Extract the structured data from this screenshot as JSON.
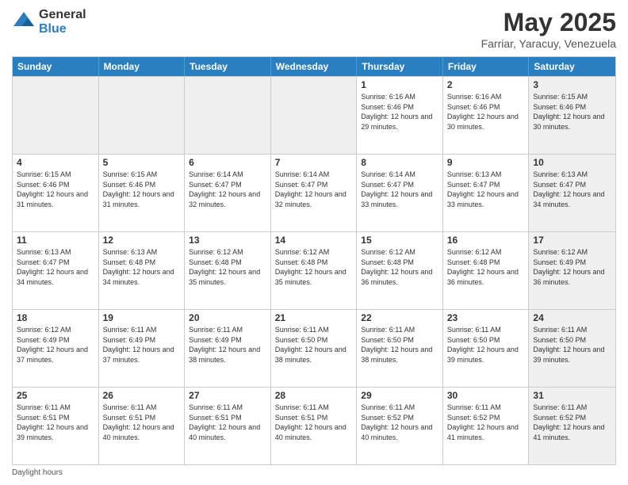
{
  "logo": {
    "general": "General",
    "blue": "Blue"
  },
  "title": "May 2025",
  "subtitle": "Farriar, Yaracuy, Venezuela",
  "days_header": [
    "Sunday",
    "Monday",
    "Tuesday",
    "Wednesday",
    "Thursday",
    "Friday",
    "Saturday"
  ],
  "footer": "Daylight hours",
  "weeks": [
    [
      {
        "day": "",
        "info": "",
        "shaded": true
      },
      {
        "day": "",
        "info": "",
        "shaded": true
      },
      {
        "day": "",
        "info": "",
        "shaded": true
      },
      {
        "day": "",
        "info": "",
        "shaded": true
      },
      {
        "day": "1",
        "info": "Sunrise: 6:16 AM\nSunset: 6:46 PM\nDaylight: 12 hours\nand 29 minutes.",
        "shaded": false
      },
      {
        "day": "2",
        "info": "Sunrise: 6:16 AM\nSunset: 6:46 PM\nDaylight: 12 hours\nand 30 minutes.",
        "shaded": false
      },
      {
        "day": "3",
        "info": "Sunrise: 6:15 AM\nSunset: 6:46 PM\nDaylight: 12 hours\nand 30 minutes.",
        "shaded": true
      }
    ],
    [
      {
        "day": "4",
        "info": "Sunrise: 6:15 AM\nSunset: 6:46 PM\nDaylight: 12 hours\nand 31 minutes.",
        "shaded": false
      },
      {
        "day": "5",
        "info": "Sunrise: 6:15 AM\nSunset: 6:46 PM\nDaylight: 12 hours\nand 31 minutes.",
        "shaded": false
      },
      {
        "day": "6",
        "info": "Sunrise: 6:14 AM\nSunset: 6:47 PM\nDaylight: 12 hours\nand 32 minutes.",
        "shaded": false
      },
      {
        "day": "7",
        "info": "Sunrise: 6:14 AM\nSunset: 6:47 PM\nDaylight: 12 hours\nand 32 minutes.",
        "shaded": false
      },
      {
        "day": "8",
        "info": "Sunrise: 6:14 AM\nSunset: 6:47 PM\nDaylight: 12 hours\nand 33 minutes.",
        "shaded": false
      },
      {
        "day": "9",
        "info": "Sunrise: 6:13 AM\nSunset: 6:47 PM\nDaylight: 12 hours\nand 33 minutes.",
        "shaded": false
      },
      {
        "day": "10",
        "info": "Sunrise: 6:13 AM\nSunset: 6:47 PM\nDaylight: 12 hours\nand 34 minutes.",
        "shaded": true
      }
    ],
    [
      {
        "day": "11",
        "info": "Sunrise: 6:13 AM\nSunset: 6:47 PM\nDaylight: 12 hours\nand 34 minutes.",
        "shaded": false
      },
      {
        "day": "12",
        "info": "Sunrise: 6:13 AM\nSunset: 6:48 PM\nDaylight: 12 hours\nand 34 minutes.",
        "shaded": false
      },
      {
        "day": "13",
        "info": "Sunrise: 6:12 AM\nSunset: 6:48 PM\nDaylight: 12 hours\nand 35 minutes.",
        "shaded": false
      },
      {
        "day": "14",
        "info": "Sunrise: 6:12 AM\nSunset: 6:48 PM\nDaylight: 12 hours\nand 35 minutes.",
        "shaded": false
      },
      {
        "day": "15",
        "info": "Sunrise: 6:12 AM\nSunset: 6:48 PM\nDaylight: 12 hours\nand 36 minutes.",
        "shaded": false
      },
      {
        "day": "16",
        "info": "Sunrise: 6:12 AM\nSunset: 6:48 PM\nDaylight: 12 hours\nand 36 minutes.",
        "shaded": false
      },
      {
        "day": "17",
        "info": "Sunrise: 6:12 AM\nSunset: 6:49 PM\nDaylight: 12 hours\nand 36 minutes.",
        "shaded": true
      }
    ],
    [
      {
        "day": "18",
        "info": "Sunrise: 6:12 AM\nSunset: 6:49 PM\nDaylight: 12 hours\nand 37 minutes.",
        "shaded": false
      },
      {
        "day": "19",
        "info": "Sunrise: 6:11 AM\nSunset: 6:49 PM\nDaylight: 12 hours\nand 37 minutes.",
        "shaded": false
      },
      {
        "day": "20",
        "info": "Sunrise: 6:11 AM\nSunset: 6:49 PM\nDaylight: 12 hours\nand 38 minutes.",
        "shaded": false
      },
      {
        "day": "21",
        "info": "Sunrise: 6:11 AM\nSunset: 6:50 PM\nDaylight: 12 hours\nand 38 minutes.",
        "shaded": false
      },
      {
        "day": "22",
        "info": "Sunrise: 6:11 AM\nSunset: 6:50 PM\nDaylight: 12 hours\nand 38 minutes.",
        "shaded": false
      },
      {
        "day": "23",
        "info": "Sunrise: 6:11 AM\nSunset: 6:50 PM\nDaylight: 12 hours\nand 39 minutes.",
        "shaded": false
      },
      {
        "day": "24",
        "info": "Sunrise: 6:11 AM\nSunset: 6:50 PM\nDaylight: 12 hours\nand 39 minutes.",
        "shaded": true
      }
    ],
    [
      {
        "day": "25",
        "info": "Sunrise: 6:11 AM\nSunset: 6:51 PM\nDaylight: 12 hours\nand 39 minutes.",
        "shaded": false
      },
      {
        "day": "26",
        "info": "Sunrise: 6:11 AM\nSunset: 6:51 PM\nDaylight: 12 hours\nand 40 minutes.",
        "shaded": false
      },
      {
        "day": "27",
        "info": "Sunrise: 6:11 AM\nSunset: 6:51 PM\nDaylight: 12 hours\nand 40 minutes.",
        "shaded": false
      },
      {
        "day": "28",
        "info": "Sunrise: 6:11 AM\nSunset: 6:51 PM\nDaylight: 12 hours\nand 40 minutes.",
        "shaded": false
      },
      {
        "day": "29",
        "info": "Sunrise: 6:11 AM\nSunset: 6:52 PM\nDaylight: 12 hours\nand 40 minutes.",
        "shaded": false
      },
      {
        "day": "30",
        "info": "Sunrise: 6:11 AM\nSunset: 6:52 PM\nDaylight: 12 hours\nand 41 minutes.",
        "shaded": false
      },
      {
        "day": "31",
        "info": "Sunrise: 6:11 AM\nSunset: 6:52 PM\nDaylight: 12 hours\nand 41 minutes.",
        "shaded": true
      }
    ]
  ]
}
